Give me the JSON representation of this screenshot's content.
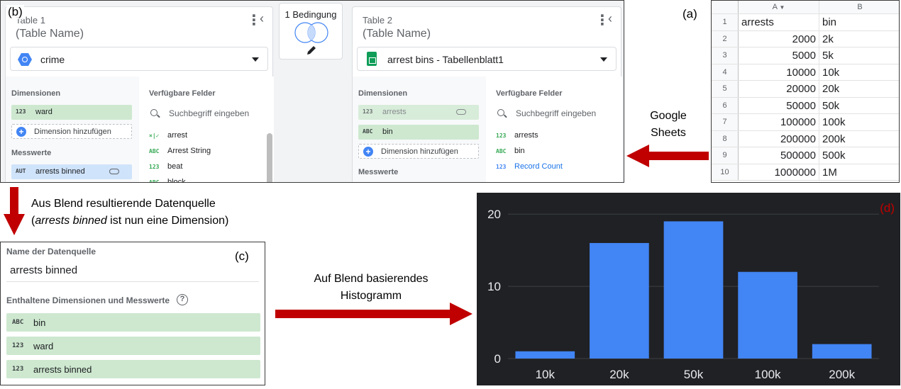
{
  "panel_b": {
    "label": "(b)",
    "condition_label": "1 Bedingung",
    "table1": {
      "number_label": "Table 1",
      "name_placeholder": "(Table Name)",
      "source": "crime",
      "dimensions_header": "Dimensionen",
      "dimensions": [
        {
          "type": "123",
          "name": "ward"
        }
      ],
      "add_dimension": "Dimension hinzufügen",
      "metrics_header": "Messwerte",
      "metrics": [
        {
          "type": "AUT",
          "name": "arrests binned"
        }
      ],
      "available_header": "Verfügbare Felder",
      "search_placeholder": "Suchbegriff eingeben",
      "available_fields": [
        {
          "type": "×|✓",
          "name": "arrest"
        },
        {
          "type": "ABC",
          "name": "Arrest String"
        },
        {
          "type": "123",
          "name": "beat"
        },
        {
          "type": "ABC",
          "name": "block"
        }
      ]
    },
    "table2": {
      "number_label": "Table 2",
      "name_placeholder": "(Table Name)",
      "source": "arrest bins - Tabellenblatt1",
      "dimensions_header": "Dimensionen",
      "dimensions": [
        {
          "type": "123",
          "name": "arrests"
        },
        {
          "type": "ABC",
          "name": "bin"
        }
      ],
      "add_dimension": "Dimension hinzufügen",
      "metrics_header": "Messwerte",
      "available_header": "Verfügbare Felder",
      "search_placeholder": "Suchbegriff eingeben",
      "available_fields": [
        {
          "type": "123",
          "name": "arrests"
        },
        {
          "type": "ABC",
          "name": "bin"
        },
        {
          "type": "123",
          "name": "Record Count"
        }
      ]
    }
  },
  "panel_a": {
    "label": "(a)",
    "columns": [
      "A",
      "B"
    ],
    "rows": [
      {
        "n": "1",
        "a": "arrests",
        "b": "bin"
      },
      {
        "n": "2",
        "a": "2000",
        "b": "2k"
      },
      {
        "n": "3",
        "a": "5000",
        "b": "5k"
      },
      {
        "n": "4",
        "a": "10000",
        "b": "10k"
      },
      {
        "n": "5",
        "a": "20000",
        "b": "20k"
      },
      {
        "n": "6",
        "a": "50000",
        "b": "50k"
      },
      {
        "n": "7",
        "a": "100000",
        "b": "100k"
      },
      {
        "n": "8",
        "a": "200000",
        "b": "200k"
      },
      {
        "n": "9",
        "a": "500000",
        "b": "500k"
      },
      {
        "n": "10",
        "a": "1000000",
        "b": "1M"
      }
    ]
  },
  "google_sheets_label": [
    "Google",
    "Sheets"
  ],
  "blend_note": {
    "line1": "Aus Blend resultierende  Datenquelle",
    "line2_open": "(",
    "line2_italic": "arrests binned",
    "line2_rest": " ist nun eine Dimension)"
  },
  "panel_c": {
    "label": "(c)",
    "source_name_header": "Name der Datenquelle",
    "source_name": "arrests binned",
    "contained_header": "Enthaltene Dimensionen und Messwerte",
    "help_icon": "?",
    "fields": [
      {
        "type": "ABC",
        "name": "bin"
      },
      {
        "type": "123",
        "name": "ward"
      },
      {
        "type": "123",
        "name": "arrests binned"
      }
    ]
  },
  "histogram_note": [
    "Auf Blend basierendes",
    "Histogramm"
  ],
  "colors": {
    "arrow": "#c00000",
    "bar": "#4285f4",
    "chart_bg": "#202124",
    "dimension_chip": "#cde8cf",
    "metric_chip": "#cfe3fb"
  },
  "chart_data": {
    "type": "bar",
    "panel_label": "(d)",
    "categories": [
      "10k",
      "20k",
      "50k",
      "100k",
      "200k"
    ],
    "values": [
      1,
      16,
      19,
      12,
      2
    ],
    "ylim": [
      0,
      21
    ],
    "yticks": [
      0,
      10,
      20
    ],
    "grid": true
  }
}
